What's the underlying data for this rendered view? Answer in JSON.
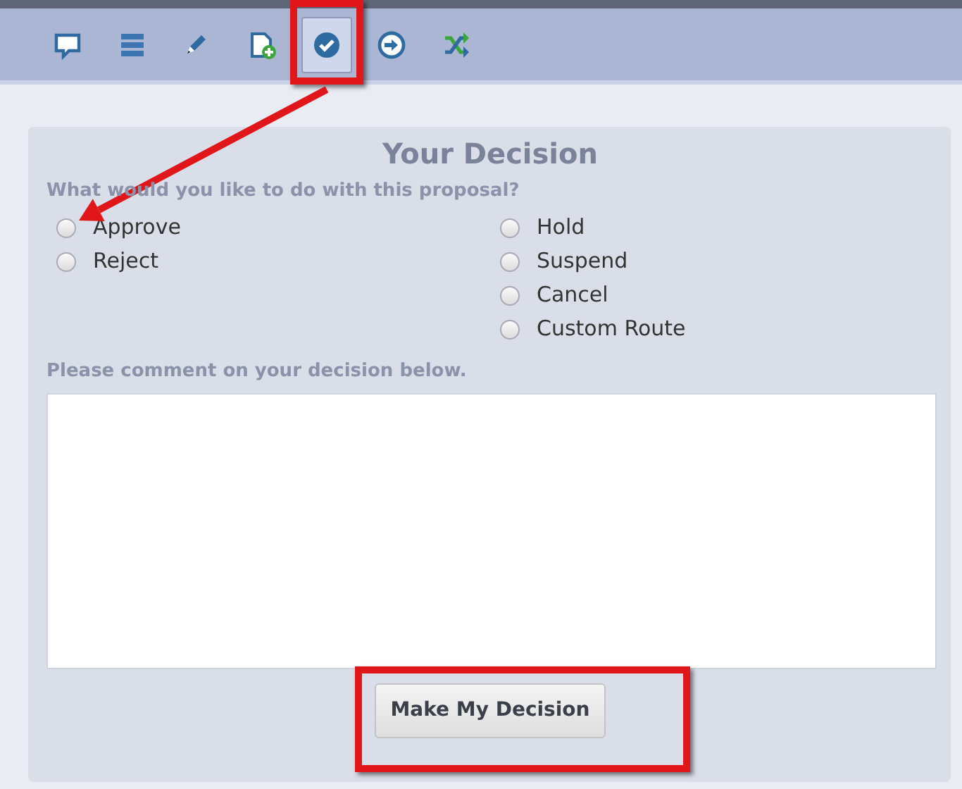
{
  "toolbar": {
    "tools": [
      {
        "kind": "comment",
        "selected": false,
        "highlighted": false
      },
      {
        "kind": "list",
        "selected": false,
        "highlighted": false
      },
      {
        "kind": "pencil",
        "selected": false,
        "highlighted": false
      },
      {
        "kind": "add-document",
        "selected": false,
        "highlighted": false
      },
      {
        "kind": "check",
        "selected": true,
        "highlighted": true
      },
      {
        "kind": "forward",
        "selected": false,
        "highlighted": false
      },
      {
        "kind": "shuffle",
        "selected": false,
        "highlighted": false
      }
    ]
  },
  "callout_arrow": true,
  "decision": {
    "title": "Your Decision",
    "question": "What would you like to do with this proposal?",
    "options_left": [
      {
        "label": "Approve",
        "selected": false
      },
      {
        "label": "Reject",
        "selected": false
      }
    ],
    "options_right": [
      {
        "label": "Hold",
        "selected": false
      },
      {
        "label": "Suspend",
        "selected": false
      },
      {
        "label": "Cancel",
        "selected": false
      },
      {
        "label": "Custom Route",
        "selected": false
      }
    ],
    "comment_label": "Please comment on your decision below.",
    "submit": {
      "label": "Make My Decision",
      "highlighted": true
    }
  }
}
